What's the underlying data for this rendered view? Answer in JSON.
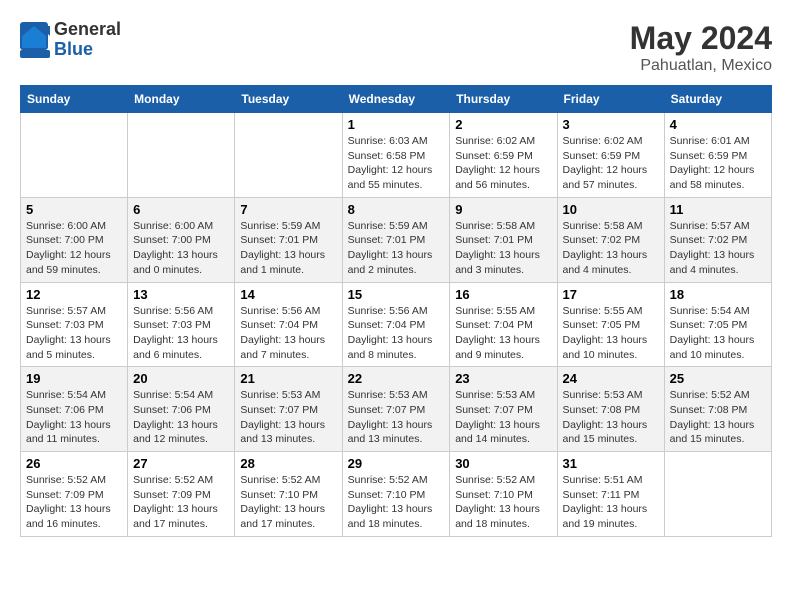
{
  "logo": {
    "general": "General",
    "blue": "Blue"
  },
  "title": "May 2024",
  "subtitle": "Pahuatlan, Mexico",
  "days_of_week": [
    "Sunday",
    "Monday",
    "Tuesday",
    "Wednesday",
    "Thursday",
    "Friday",
    "Saturday"
  ],
  "weeks": [
    [
      {
        "day": "",
        "info": ""
      },
      {
        "day": "",
        "info": ""
      },
      {
        "day": "",
        "info": ""
      },
      {
        "day": "1",
        "info": "Sunrise: 6:03 AM\nSunset: 6:58 PM\nDaylight: 12 hours and 55 minutes."
      },
      {
        "day": "2",
        "info": "Sunrise: 6:02 AM\nSunset: 6:59 PM\nDaylight: 12 hours and 56 minutes."
      },
      {
        "day": "3",
        "info": "Sunrise: 6:02 AM\nSunset: 6:59 PM\nDaylight: 12 hours and 57 minutes."
      },
      {
        "day": "4",
        "info": "Sunrise: 6:01 AM\nSunset: 6:59 PM\nDaylight: 12 hours and 58 minutes."
      }
    ],
    [
      {
        "day": "5",
        "info": "Sunrise: 6:00 AM\nSunset: 7:00 PM\nDaylight: 12 hours and 59 minutes."
      },
      {
        "day": "6",
        "info": "Sunrise: 6:00 AM\nSunset: 7:00 PM\nDaylight: 13 hours and 0 minutes."
      },
      {
        "day": "7",
        "info": "Sunrise: 5:59 AM\nSunset: 7:01 PM\nDaylight: 13 hours and 1 minute."
      },
      {
        "day": "8",
        "info": "Sunrise: 5:59 AM\nSunset: 7:01 PM\nDaylight: 13 hours and 2 minutes."
      },
      {
        "day": "9",
        "info": "Sunrise: 5:58 AM\nSunset: 7:01 PM\nDaylight: 13 hours and 3 minutes."
      },
      {
        "day": "10",
        "info": "Sunrise: 5:58 AM\nSunset: 7:02 PM\nDaylight: 13 hours and 4 minutes."
      },
      {
        "day": "11",
        "info": "Sunrise: 5:57 AM\nSunset: 7:02 PM\nDaylight: 13 hours and 4 minutes."
      }
    ],
    [
      {
        "day": "12",
        "info": "Sunrise: 5:57 AM\nSunset: 7:03 PM\nDaylight: 13 hours and 5 minutes."
      },
      {
        "day": "13",
        "info": "Sunrise: 5:56 AM\nSunset: 7:03 PM\nDaylight: 13 hours and 6 minutes."
      },
      {
        "day": "14",
        "info": "Sunrise: 5:56 AM\nSunset: 7:04 PM\nDaylight: 13 hours and 7 minutes."
      },
      {
        "day": "15",
        "info": "Sunrise: 5:56 AM\nSunset: 7:04 PM\nDaylight: 13 hours and 8 minutes."
      },
      {
        "day": "16",
        "info": "Sunrise: 5:55 AM\nSunset: 7:04 PM\nDaylight: 13 hours and 9 minutes."
      },
      {
        "day": "17",
        "info": "Sunrise: 5:55 AM\nSunset: 7:05 PM\nDaylight: 13 hours and 10 minutes."
      },
      {
        "day": "18",
        "info": "Sunrise: 5:54 AM\nSunset: 7:05 PM\nDaylight: 13 hours and 10 minutes."
      }
    ],
    [
      {
        "day": "19",
        "info": "Sunrise: 5:54 AM\nSunset: 7:06 PM\nDaylight: 13 hours and 11 minutes."
      },
      {
        "day": "20",
        "info": "Sunrise: 5:54 AM\nSunset: 7:06 PM\nDaylight: 13 hours and 12 minutes."
      },
      {
        "day": "21",
        "info": "Sunrise: 5:53 AM\nSunset: 7:07 PM\nDaylight: 13 hours and 13 minutes."
      },
      {
        "day": "22",
        "info": "Sunrise: 5:53 AM\nSunset: 7:07 PM\nDaylight: 13 hours and 13 minutes."
      },
      {
        "day": "23",
        "info": "Sunrise: 5:53 AM\nSunset: 7:07 PM\nDaylight: 13 hours and 14 minutes."
      },
      {
        "day": "24",
        "info": "Sunrise: 5:53 AM\nSunset: 7:08 PM\nDaylight: 13 hours and 15 minutes."
      },
      {
        "day": "25",
        "info": "Sunrise: 5:52 AM\nSunset: 7:08 PM\nDaylight: 13 hours and 15 minutes."
      }
    ],
    [
      {
        "day": "26",
        "info": "Sunrise: 5:52 AM\nSunset: 7:09 PM\nDaylight: 13 hours and 16 minutes."
      },
      {
        "day": "27",
        "info": "Sunrise: 5:52 AM\nSunset: 7:09 PM\nDaylight: 13 hours and 17 minutes."
      },
      {
        "day": "28",
        "info": "Sunrise: 5:52 AM\nSunset: 7:10 PM\nDaylight: 13 hours and 17 minutes."
      },
      {
        "day": "29",
        "info": "Sunrise: 5:52 AM\nSunset: 7:10 PM\nDaylight: 13 hours and 18 minutes."
      },
      {
        "day": "30",
        "info": "Sunrise: 5:52 AM\nSunset: 7:10 PM\nDaylight: 13 hours and 18 minutes."
      },
      {
        "day": "31",
        "info": "Sunrise: 5:51 AM\nSunset: 7:11 PM\nDaylight: 13 hours and 19 minutes."
      },
      {
        "day": "",
        "info": ""
      }
    ]
  ]
}
